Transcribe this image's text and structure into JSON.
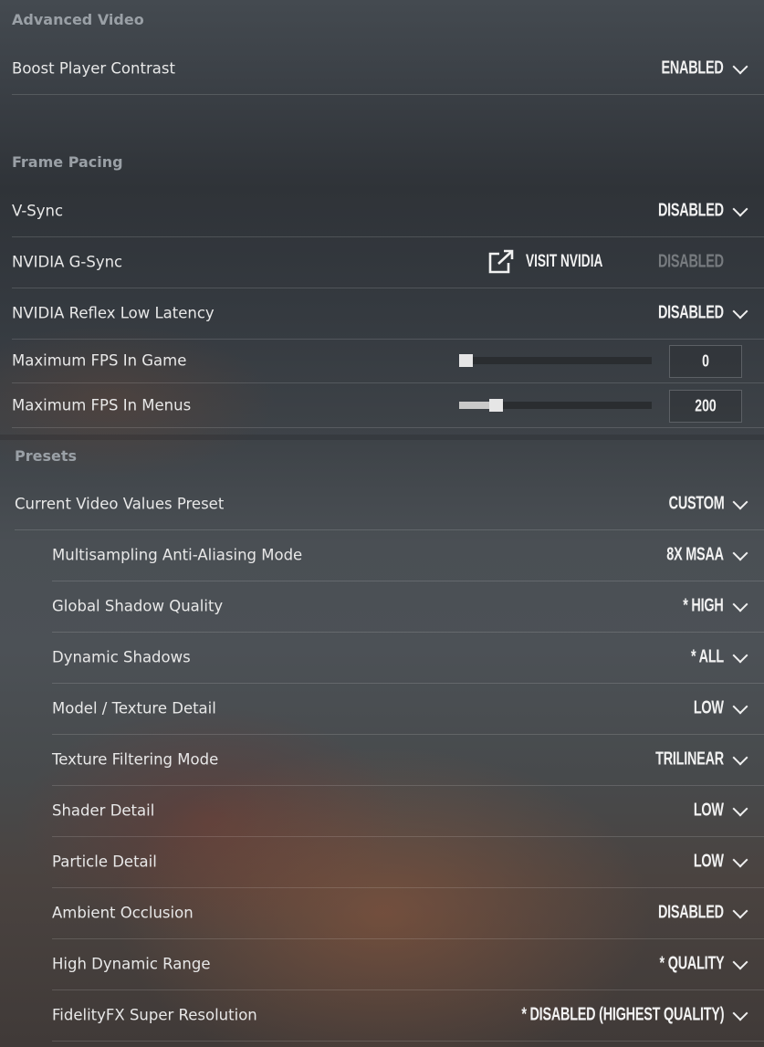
{
  "advanced_video": {
    "title": "Advanced Video",
    "boost_player_contrast": {
      "label": "Boost Player Contrast",
      "value": "ENABLED"
    }
  },
  "frame_pacing": {
    "title": "Frame Pacing",
    "vsync": {
      "label": "V-Sync",
      "value": "DISABLED"
    },
    "gsync": {
      "label": "NVIDIA G-Sync",
      "link_label": "VISIT NVIDIA",
      "value": "DISABLED"
    },
    "reflex": {
      "label": "NVIDIA Reflex Low Latency",
      "value": "DISABLED"
    },
    "max_fps_game": {
      "label": "Maximum FPS In Game",
      "value": "0",
      "fraction": 0.0
    },
    "max_fps_menus": {
      "label": "Maximum FPS In Menus",
      "value": "200",
      "fraction": 0.17
    }
  },
  "presets": {
    "title": "Presets",
    "current_preset": {
      "label": "Current Video Values Preset",
      "value": "CUSTOM"
    },
    "items": [
      {
        "label": "Multisampling Anti-Aliasing Mode",
        "value": "8X MSAA"
      },
      {
        "label": "Global Shadow Quality",
        "value": "* HIGH"
      },
      {
        "label": "Dynamic Shadows",
        "value": "* ALL"
      },
      {
        "label": "Model / Texture Detail",
        "value": "LOW"
      },
      {
        "label": "Texture Filtering Mode",
        "value": "TRILINEAR"
      },
      {
        "label": "Shader Detail",
        "value": "LOW"
      },
      {
        "label": "Particle Detail",
        "value": "LOW"
      },
      {
        "label": "Ambient Occlusion",
        "value": "DISABLED"
      },
      {
        "label": "High Dynamic Range",
        "value": "* QUALITY"
      },
      {
        "label": "FidelityFX Super Resolution",
        "value": "* DISABLED (HIGHEST QUALITY)"
      }
    ]
  },
  "icons": {
    "external_link": "external-link-icon",
    "dropdown": "chevron-down-icon"
  },
  "colors": {
    "section_title": "#9aa0a6",
    "muted_value": "#777b7f",
    "slider_handle": "#e6e6e6"
  }
}
